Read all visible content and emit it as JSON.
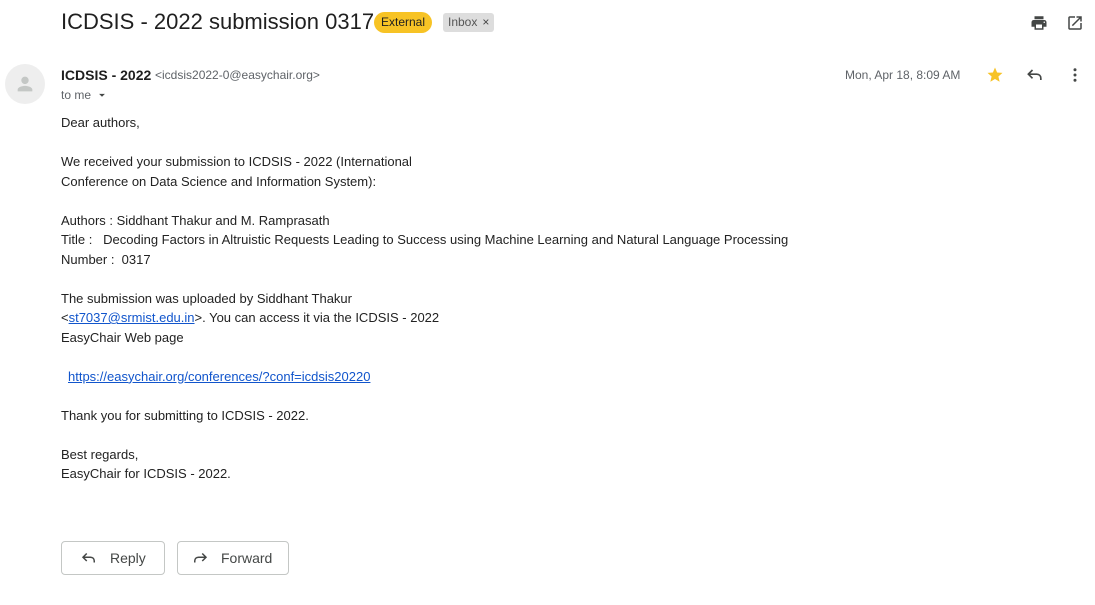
{
  "email": {
    "subject": "ICDSIS - 2022 submission 0317",
    "labels": {
      "external": "External",
      "inbox": "Inbox",
      "remove_label_glyph": "×"
    },
    "toolbar_icons": [
      "print-icon",
      "open-in-new-window-icon"
    ],
    "sender": {
      "name": "ICDSIS - 2022",
      "email": "<icdsis2022-0@easychair.org>"
    },
    "recipient": "to me",
    "date": "Mon, Apr 18, 8:09 AM",
    "body": {
      "greeting": "Dear authors,",
      "received_line1": "We received your submission to ICDSIS - 2022 (International",
      "received_line2": "Conference on Data Science and Information System):",
      "authors": "Authors : Siddhant Thakur and M. Ramprasath",
      "title": "Title :   Decoding Factors in Altruistic Requests Leading to Success using Machine Learning and Natural Language Processing",
      "number": "Number :  0317",
      "uploaded_line1": "The submission was uploaded by Siddhant Thakur",
      "uploader_open": "<",
      "uploader_email": "st7037@srmist.edu.in",
      "uploader_rest": ">. You can access it via the ICDSIS - 2022",
      "uploaded_line3": "EasyChair Web page",
      "conference_link": "https://easychair.org/conferences/?conf=icdsis20220",
      "thanks": "Thank you for submitting to ICDSIS - 2022.",
      "regards": "Best regards,",
      "signature": "EasyChair for ICDSIS - 2022."
    },
    "actions": {
      "reply": "Reply",
      "forward": "Forward"
    }
  },
  "colors": {
    "external_badge": "#f7c325",
    "inbox_badge": "#dddddd",
    "star": "#f7c325",
    "link": "#1155cc"
  }
}
